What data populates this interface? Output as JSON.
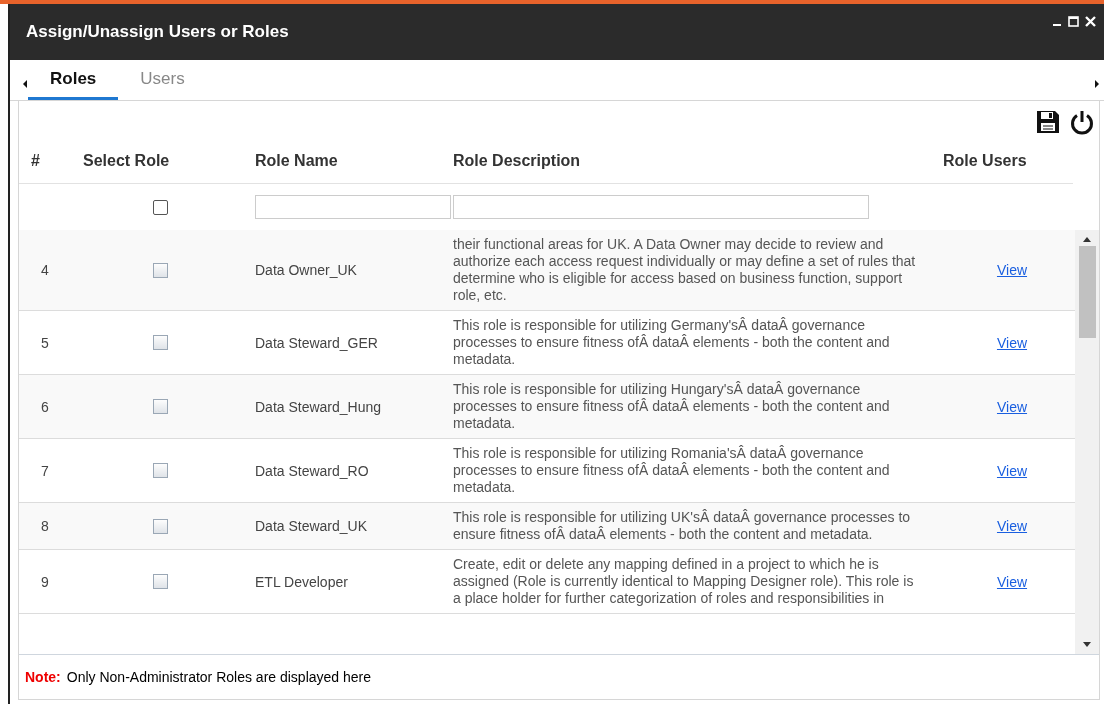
{
  "window": {
    "title": "Assign/Unassign Users or Roles"
  },
  "tabs": [
    {
      "label": "Roles",
      "selected": true
    },
    {
      "label": "Users",
      "selected": false
    }
  ],
  "table": {
    "columns": [
      "#",
      "Select Role",
      "Role Name",
      "Role Description",
      "Role Users"
    ],
    "filter": {
      "select_all": {
        "checked": false
      }
    },
    "rows": [
      {
        "number": "4",
        "checked": false,
        "name": "Data Owner_UK",
        "description": "their functional areas for UK. A Data Owner may decide to review and authorize each access request individually or may define a set of rules that determine who is eligible for access based on business function, support role, etc.",
        "users_link": "View"
      },
      {
        "number": "5",
        "checked": false,
        "name": "Data Steward_GER",
        "description": "This role is responsible for utilizing Germany'sÂ dataÂ governance processes to ensure fitness ofÂ dataÂ elements - both the content and metadata.",
        "users_link": "View"
      },
      {
        "number": "6",
        "checked": false,
        "name": "Data Steward_Hung",
        "description": "This role is responsible for utilizing Hungary'sÂ dataÂ governance processes to ensure fitness ofÂ dataÂ elements - both the content and metadata.",
        "users_link": "View"
      },
      {
        "number": "7",
        "checked": false,
        "name": "Data Steward_RO",
        "description": "This role is responsible for utilizing Romania'sÂ dataÂ governance processes to ensure fitness ofÂ dataÂ elements - both the content and metadata.",
        "users_link": "View"
      },
      {
        "number": "8",
        "checked": false,
        "name": "Data Steward_UK",
        "description": "This role is responsible for utilizing UK'sÂ dataÂ governance processes to ensure fitness ofÂ dataÂ elements - both the content and metadata.",
        "users_link": "View"
      },
      {
        "number": "9",
        "checked": false,
        "name": "ETL Developer",
        "description": "Create, edit or delete any mapping defined in a project to which he is assigned (Role is currently identical to Mapping Designer role). This role is a place holder for further categorization of roles and responsibilities in",
        "users_link": "View"
      }
    ]
  },
  "note": {
    "label": "Note:",
    "text": "Only Non-Administrator Roles are displayed here"
  }
}
